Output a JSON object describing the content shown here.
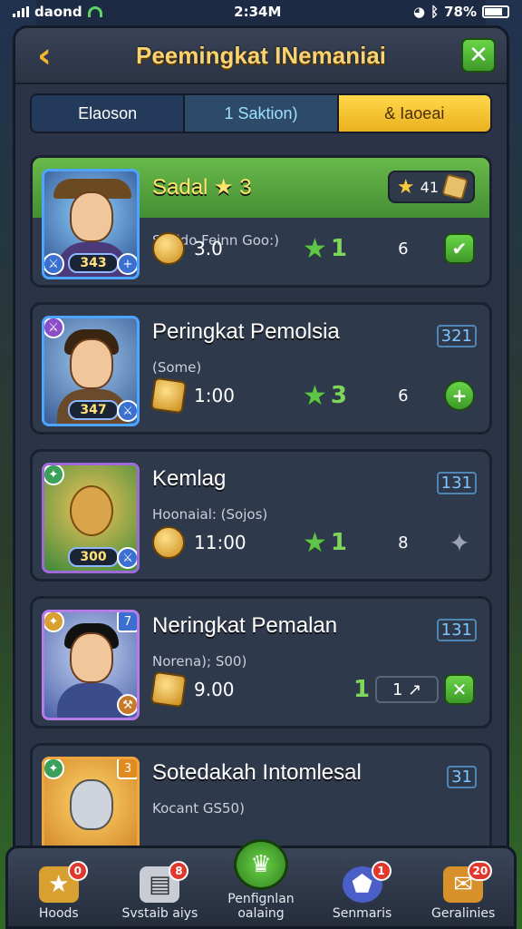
{
  "status_bar": {
    "carrier": "daond",
    "time": "2:34M",
    "battery": "78%",
    "battery_level": 0.78
  },
  "header": {
    "title": "Peemingkat INemaniai",
    "back_icon": "chevron-left-icon",
    "close_icon": "close-icon"
  },
  "tabs": [
    {
      "label": "Elaoson"
    },
    {
      "label": "1 Saktion)"
    },
    {
      "label": "& Iaoeai"
    }
  ],
  "rows": [
    {
      "name": "Sadal ★ 3",
      "sub": "Sosido Feinn Goo:)",
      "rank": "41",
      "level": "343",
      "score": "3.0",
      "stars": "1",
      "num": "6",
      "action": "✔"
    },
    {
      "name": "Peringkat Pemolsia",
      "sub": "(Some)",
      "rank": "321",
      "level": "347",
      "score": "1:00",
      "stars": "3",
      "num": "6",
      "action": "+"
    },
    {
      "name": "Kemlag",
      "sub": "Hoonaial: (Sojos)",
      "rank": "131",
      "level": "300",
      "score": "11:00",
      "stars": "1",
      "num": "8",
      "action": "✦"
    },
    {
      "name": "Neringkat Pemalan",
      "sub": "Norena); S00)",
      "rank": "131",
      "level": "7",
      "score": "9.00",
      "stars": "1",
      "mini": "1 ↗",
      "action": "✕"
    },
    {
      "name": "Sotedakah Intomlesal",
      "sub": "Kocant GS50)",
      "rank": "31",
      "level": "3"
    }
  ],
  "nav": [
    {
      "label": "Hoods",
      "badge": "0"
    },
    {
      "label": "Svstaib aiys",
      "badge": "8"
    },
    {
      "label": "Penfignlan oalaing",
      "badge": ""
    },
    {
      "label": "Senmaris",
      "badge": "1"
    },
    {
      "label": "Geralinies",
      "badge": "20"
    }
  ]
}
